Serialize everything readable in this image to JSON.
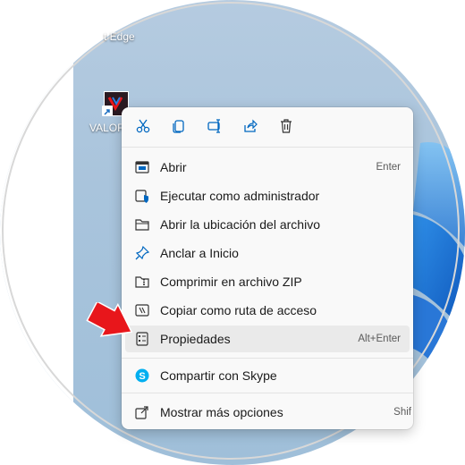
{
  "desktop": {
    "edge_label": "t Edge",
    "app_label": "VALOR"
  },
  "context_menu": {
    "quick_actions": [
      {
        "name": "cut-icon"
      },
      {
        "name": "copy-icon"
      },
      {
        "name": "rename-icon"
      },
      {
        "name": "share-icon"
      },
      {
        "name": "delete-icon"
      }
    ],
    "items": [
      {
        "label": "Abrir",
        "shortcut": "Enter",
        "icon": "open-icon"
      },
      {
        "label": "Ejecutar como administrador",
        "shortcut": "",
        "icon": "admin-shield-icon"
      },
      {
        "label": "Abrir la ubicación del archivo",
        "shortcut": "",
        "icon": "folder-icon"
      },
      {
        "label": "Anclar a Inicio",
        "shortcut": "",
        "icon": "pin-icon"
      },
      {
        "label": "Comprimir en archivo ZIP",
        "shortcut": "",
        "icon": "zip-folder-icon"
      },
      {
        "label": "Copiar como ruta de acceso",
        "shortcut": "",
        "icon": "copy-path-icon"
      },
      {
        "label": "Propiedades",
        "shortcut": "Alt+Enter",
        "icon": "properties-icon"
      },
      {
        "label": "Compartir con Skype",
        "shortcut": "",
        "icon": "skype-icon"
      },
      {
        "label": "Mostrar más opciones",
        "shortcut": "Shif",
        "icon": "more-options-icon"
      }
    ]
  },
  "colors": {
    "accent": "#0067c0",
    "annotation_arrow": "#e8161b",
    "skype": "#00aff0"
  }
}
